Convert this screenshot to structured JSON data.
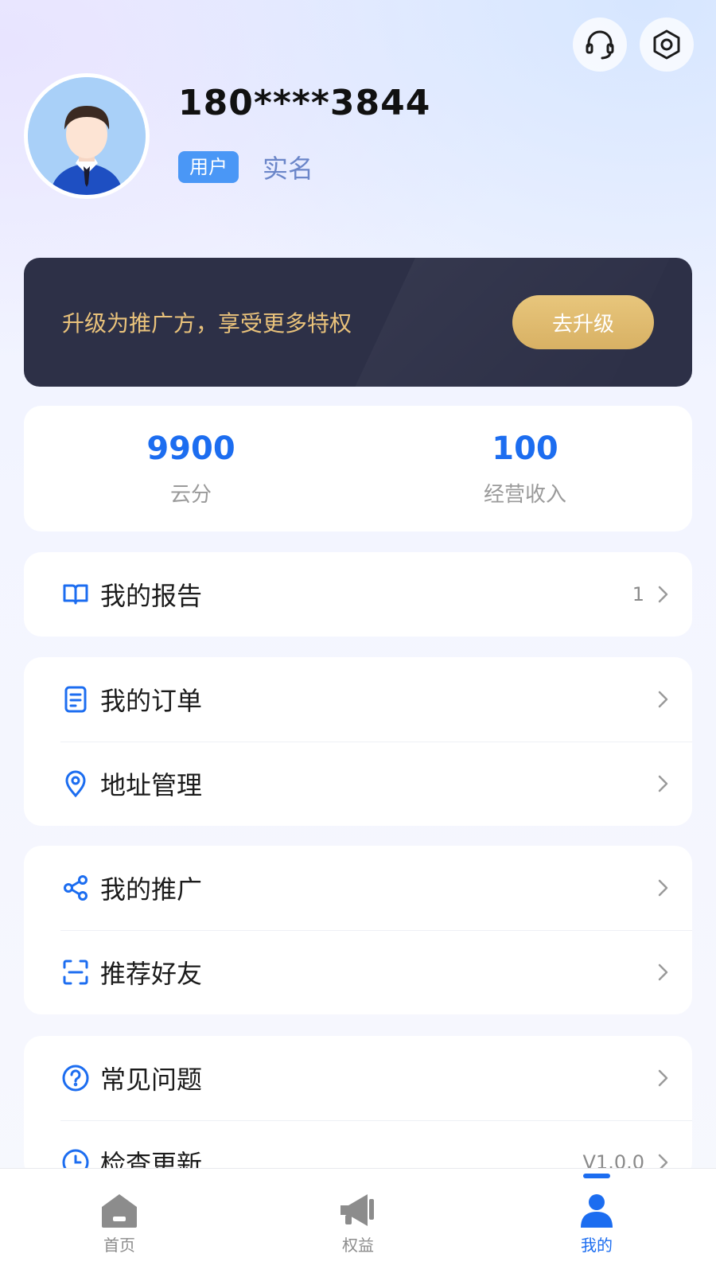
{
  "profile": {
    "phone": "180****3844",
    "role_tag": "用户",
    "realname_label": "实名"
  },
  "vip_banner": {
    "text": "升级为推广方，享受更多特权",
    "button_label": "去升级"
  },
  "stats": [
    {
      "value": "9900",
      "label": "云分"
    },
    {
      "value": "100",
      "label": "经营收入"
    }
  ],
  "menu": {
    "report": {
      "label": "我的报告",
      "value": "1",
      "icon": "book-icon"
    },
    "orders": {
      "label": "我的订单",
      "icon": "document-icon"
    },
    "address": {
      "label": "地址管理",
      "icon": "location-pin-icon"
    },
    "promotion": {
      "label": "我的推广",
      "icon": "share-icon"
    },
    "recommend": {
      "label": "推荐好友",
      "icon": "scan-icon"
    },
    "faq": {
      "label": "常见问题",
      "icon": "question-icon"
    },
    "update": {
      "label": "检查更新",
      "value": "V1.0.0",
      "icon": "clock-icon"
    }
  },
  "tabbar": {
    "home": "首页",
    "benefits": "权益",
    "mine": "我的"
  },
  "colors": {
    "accent": "#1c6df0",
    "banner_bg": "#2d3047",
    "banner_text": "#e9c27b",
    "banner_button": "#dcb768"
  }
}
